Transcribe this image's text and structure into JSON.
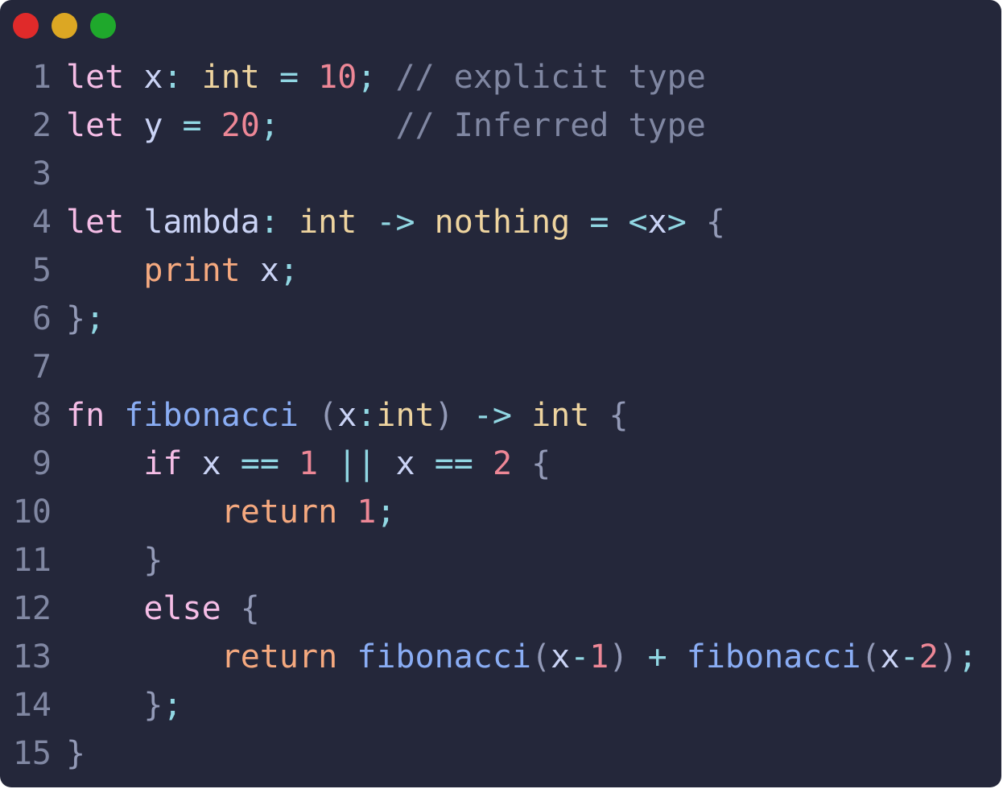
{
  "window": {
    "controls": [
      {
        "name": "close",
        "color": "#e02a2a"
      },
      {
        "name": "minimize",
        "color": "#dca723"
      },
      {
        "name": "maximize",
        "color": "#1fa82c"
      }
    ]
  },
  "theme": {
    "background": "#24273a",
    "line_number": "#8087a2",
    "keyword": "#f5bde6",
    "variable": "#cad3f5",
    "type": "#eed49f",
    "number": "#ed8796",
    "operator": "#91d7e3",
    "punct": "#939ab7",
    "comment": "#8087a2",
    "function": "#8aadf4",
    "builtin": "#f5a97f",
    "control": "#f5bde6"
  },
  "code_lines": [
    {
      "num": "1",
      "tokens": [
        {
          "t": "let",
          "k": "keyword"
        },
        {
          "t": " ",
          "k": "variable"
        },
        {
          "t": "x",
          "k": "variable"
        },
        {
          "t": ":",
          "k": "operator"
        },
        {
          "t": " ",
          "k": "variable"
        },
        {
          "t": "int",
          "k": "type"
        },
        {
          "t": " ",
          "k": "variable"
        },
        {
          "t": "=",
          "k": "operator"
        },
        {
          "t": " ",
          "k": "variable"
        },
        {
          "t": "10",
          "k": "number"
        },
        {
          "t": ";",
          "k": "operator"
        },
        {
          "t": " ",
          "k": "variable"
        },
        {
          "t": "// explicit type",
          "k": "comment"
        }
      ]
    },
    {
      "num": "2",
      "tokens": [
        {
          "t": "let",
          "k": "keyword"
        },
        {
          "t": " ",
          "k": "variable"
        },
        {
          "t": "y",
          "k": "variable"
        },
        {
          "t": " ",
          "k": "variable"
        },
        {
          "t": "=",
          "k": "operator"
        },
        {
          "t": " ",
          "k": "variable"
        },
        {
          "t": "20",
          "k": "number"
        },
        {
          "t": ";",
          "k": "operator"
        },
        {
          "t": "      ",
          "k": "variable"
        },
        {
          "t": "// Inferred type",
          "k": "comment"
        }
      ]
    },
    {
      "num": "3",
      "tokens": []
    },
    {
      "num": "4",
      "tokens": [
        {
          "t": "let",
          "k": "keyword"
        },
        {
          "t": " ",
          "k": "variable"
        },
        {
          "t": "lambda",
          "k": "variable"
        },
        {
          "t": ":",
          "k": "operator"
        },
        {
          "t": " ",
          "k": "variable"
        },
        {
          "t": "int",
          "k": "type"
        },
        {
          "t": " ",
          "k": "variable"
        },
        {
          "t": "->",
          "k": "operator"
        },
        {
          "t": " ",
          "k": "variable"
        },
        {
          "t": "nothing",
          "k": "type"
        },
        {
          "t": " ",
          "k": "variable"
        },
        {
          "t": "=",
          "k": "operator"
        },
        {
          "t": " ",
          "k": "variable"
        },
        {
          "t": "<",
          "k": "operator"
        },
        {
          "t": "x",
          "k": "variable"
        },
        {
          "t": ">",
          "k": "operator"
        },
        {
          "t": " ",
          "k": "variable"
        },
        {
          "t": "{",
          "k": "punct"
        }
      ]
    },
    {
      "num": "5",
      "tokens": [
        {
          "t": "    ",
          "k": "variable"
        },
        {
          "t": "print",
          "k": "builtin"
        },
        {
          "t": " ",
          "k": "variable"
        },
        {
          "t": "x",
          "k": "variable"
        },
        {
          "t": ";",
          "k": "operator"
        }
      ]
    },
    {
      "num": "6",
      "tokens": [
        {
          "t": "}",
          "k": "punct"
        },
        {
          "t": ";",
          "k": "operator"
        }
      ]
    },
    {
      "num": "7",
      "tokens": []
    },
    {
      "num": "8",
      "tokens": [
        {
          "t": "fn",
          "k": "keyword"
        },
        {
          "t": " ",
          "k": "variable"
        },
        {
          "t": "fibonacci",
          "k": "function"
        },
        {
          "t": " ",
          "k": "variable"
        },
        {
          "t": "(",
          "k": "punct"
        },
        {
          "t": "x",
          "k": "variable"
        },
        {
          "t": ":",
          "k": "operator"
        },
        {
          "t": "int",
          "k": "type"
        },
        {
          "t": ")",
          "k": "punct"
        },
        {
          "t": " ",
          "k": "variable"
        },
        {
          "t": "->",
          "k": "operator"
        },
        {
          "t": " ",
          "k": "variable"
        },
        {
          "t": "int",
          "k": "type"
        },
        {
          "t": " ",
          "k": "variable"
        },
        {
          "t": "{",
          "k": "punct"
        }
      ]
    },
    {
      "num": "9",
      "tokens": [
        {
          "t": "    ",
          "k": "variable"
        },
        {
          "t": "if",
          "k": "control"
        },
        {
          "t": " ",
          "k": "variable"
        },
        {
          "t": "x",
          "k": "variable"
        },
        {
          "t": " ",
          "k": "variable"
        },
        {
          "t": "==",
          "k": "operator"
        },
        {
          "t": " ",
          "k": "variable"
        },
        {
          "t": "1",
          "k": "number"
        },
        {
          "t": " ",
          "k": "variable"
        },
        {
          "t": "||",
          "k": "operator"
        },
        {
          "t": " ",
          "k": "variable"
        },
        {
          "t": "x",
          "k": "variable"
        },
        {
          "t": " ",
          "k": "variable"
        },
        {
          "t": "==",
          "k": "operator"
        },
        {
          "t": " ",
          "k": "variable"
        },
        {
          "t": "2",
          "k": "number"
        },
        {
          "t": " ",
          "k": "variable"
        },
        {
          "t": "{",
          "k": "punct"
        }
      ]
    },
    {
      "num": "10",
      "tokens": [
        {
          "t": "        ",
          "k": "variable"
        },
        {
          "t": "return",
          "k": "builtin"
        },
        {
          "t": " ",
          "k": "variable"
        },
        {
          "t": "1",
          "k": "number"
        },
        {
          "t": ";",
          "k": "operator"
        }
      ]
    },
    {
      "num": "11",
      "tokens": [
        {
          "t": "    ",
          "k": "variable"
        },
        {
          "t": "}",
          "k": "punct"
        }
      ]
    },
    {
      "num": "12",
      "tokens": [
        {
          "t": "    ",
          "k": "variable"
        },
        {
          "t": "else",
          "k": "control"
        },
        {
          "t": " ",
          "k": "variable"
        },
        {
          "t": "{",
          "k": "punct"
        }
      ]
    },
    {
      "num": "13",
      "tokens": [
        {
          "t": "        ",
          "k": "variable"
        },
        {
          "t": "return",
          "k": "builtin"
        },
        {
          "t": " ",
          "k": "variable"
        },
        {
          "t": "fibonacci",
          "k": "function"
        },
        {
          "t": "(",
          "k": "punct"
        },
        {
          "t": "x",
          "k": "variable"
        },
        {
          "t": "-",
          "k": "operator"
        },
        {
          "t": "1",
          "k": "number"
        },
        {
          "t": ")",
          "k": "punct"
        },
        {
          "t": " ",
          "k": "variable"
        },
        {
          "t": "+",
          "k": "operator"
        },
        {
          "t": " ",
          "k": "variable"
        },
        {
          "t": "fibonacci",
          "k": "function"
        },
        {
          "t": "(",
          "k": "punct"
        },
        {
          "t": "x",
          "k": "variable"
        },
        {
          "t": "-",
          "k": "operator"
        },
        {
          "t": "2",
          "k": "number"
        },
        {
          "t": ")",
          "k": "punct"
        },
        {
          "t": ";",
          "k": "operator"
        }
      ]
    },
    {
      "num": "14",
      "tokens": [
        {
          "t": "    ",
          "k": "variable"
        },
        {
          "t": "}",
          "k": "punct"
        },
        {
          "t": ";",
          "k": "operator"
        }
      ]
    },
    {
      "num": "15",
      "tokens": [
        {
          "t": "}",
          "k": "punct"
        }
      ]
    }
  ]
}
